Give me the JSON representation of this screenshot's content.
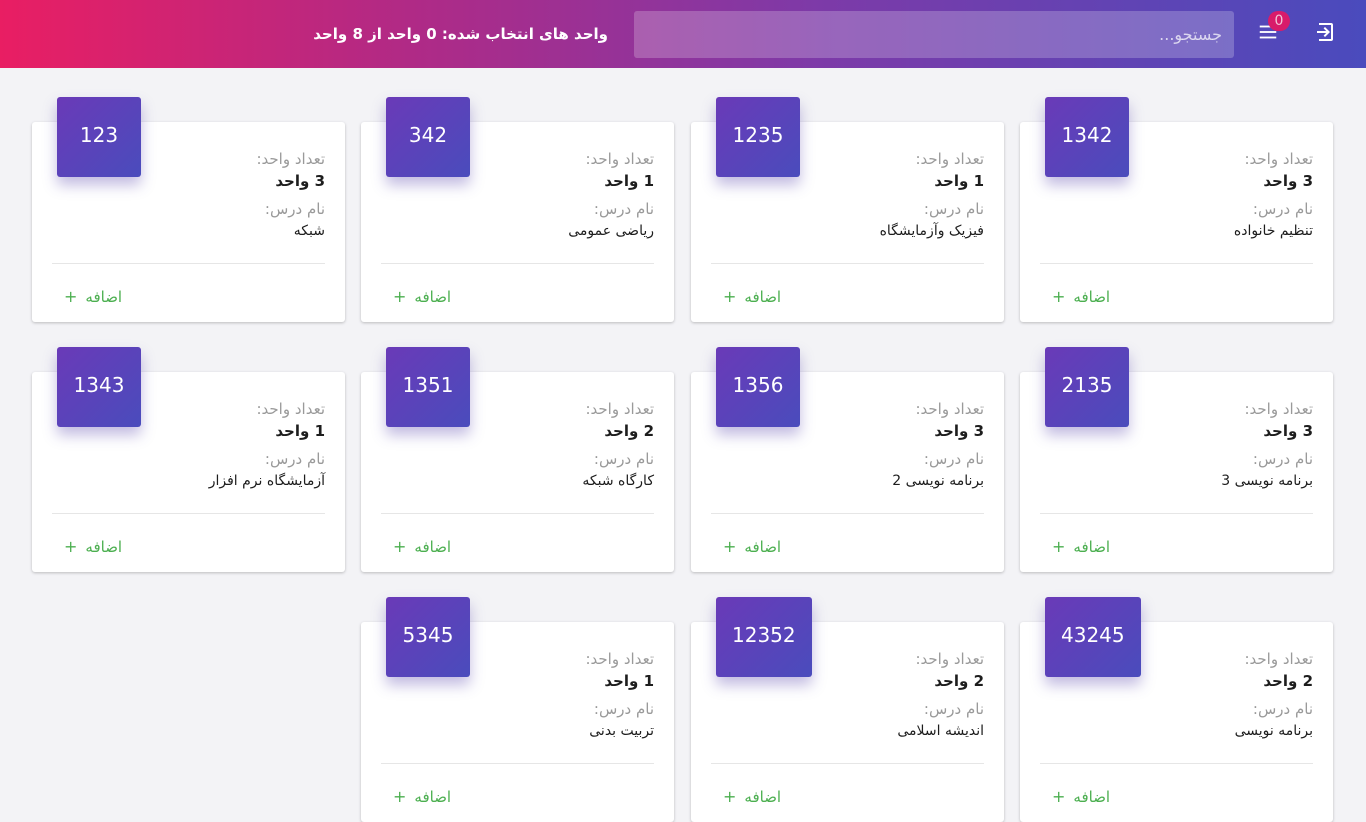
{
  "header": {
    "selected_units_text": "واحد های انتخاب شده: 0 واحد از 8 واحد",
    "search_placeholder": "جستجو...",
    "search_value": "",
    "cart_count": "0",
    "icons": {
      "logout": "logout-icon",
      "menu": "menu-icon"
    }
  },
  "colors": {
    "header_gradient": [
      "#e91e63",
      "#4a4bbd"
    ],
    "code_badge": "#5b40b8",
    "add_action": "#4caf50",
    "badge": "#d81b6a"
  },
  "card_labels": {
    "units_label": "تعداد واحد:",
    "course_label": "نام درس:",
    "add_label": "اضافه",
    "add_icon": "+"
  },
  "courses": [
    {
      "code": "1342",
      "units": "3 واحد",
      "name": "تنظیم خانواده"
    },
    {
      "code": "1235",
      "units": "1 واحد",
      "name": "فیزیک وآزمایشگاه"
    },
    {
      "code": "342",
      "units": "1 واحد",
      "name": "ریاضی عمومی"
    },
    {
      "code": "123",
      "units": "3 واحد",
      "name": "شبکه"
    },
    {
      "code": "2135",
      "units": "3 واحد",
      "name": "برنامه نویسی 3"
    },
    {
      "code": "1356",
      "units": "3 واحد",
      "name": "برنامه نویسی 2"
    },
    {
      "code": "1351",
      "units": "2 واحد",
      "name": "کارگاه شبکه"
    },
    {
      "code": "1343",
      "units": "1 واحد",
      "name": "آزمایشگاه نرم افزار"
    },
    {
      "code": "43245",
      "units": "2 واحد",
      "name": "برنامه نویسی"
    },
    {
      "code": "12352",
      "units": "2 واحد",
      "name": "اندیشه اسلامی"
    },
    {
      "code": "5345",
      "units": "1 واحد",
      "name": "تربیت بدنی"
    }
  ]
}
